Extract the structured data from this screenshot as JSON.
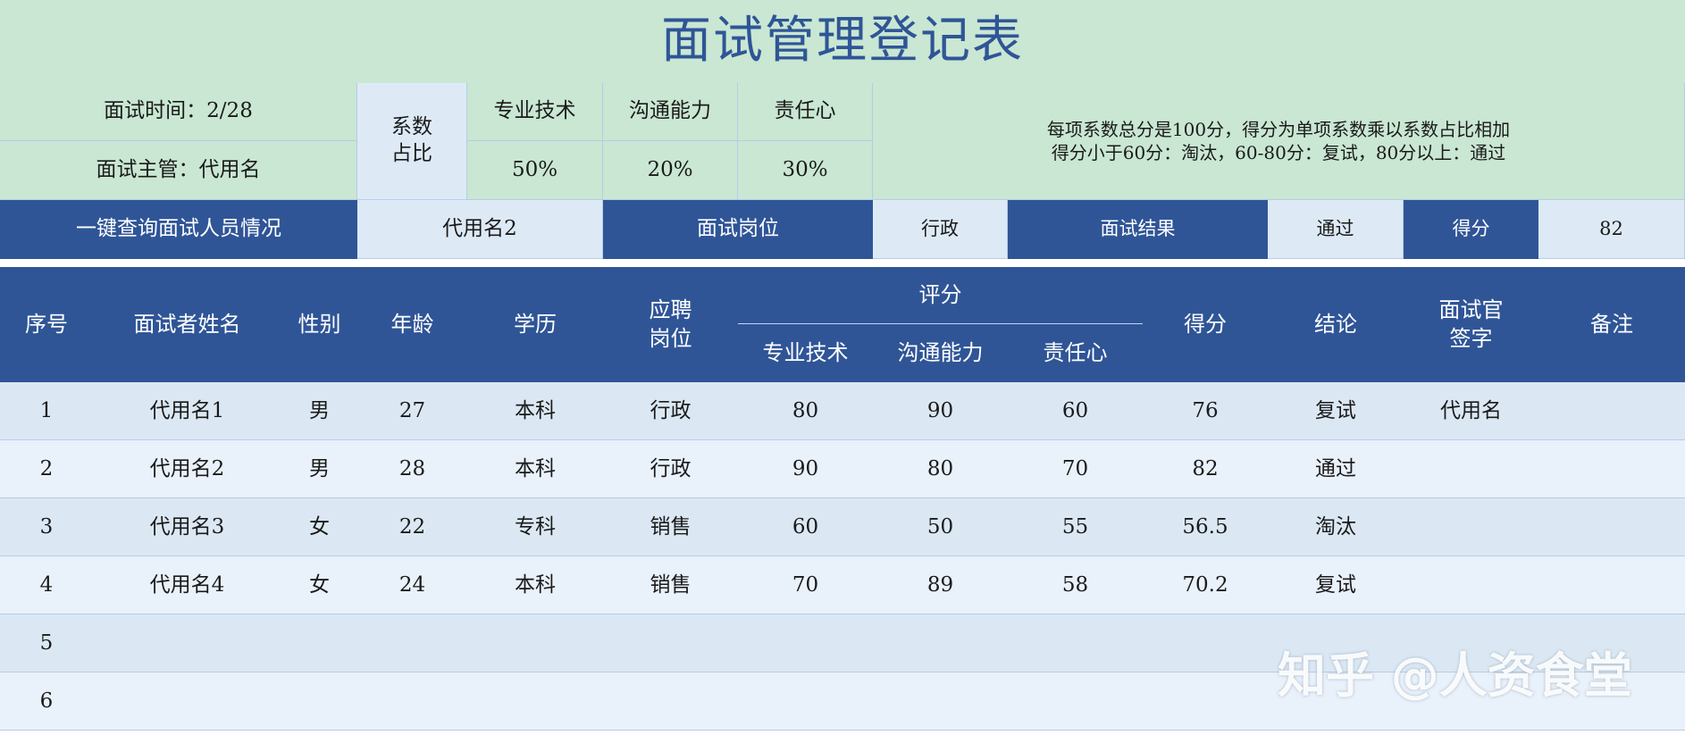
{
  "title": "面试管理登记表",
  "info": {
    "interview_date": "面试时间：2/28",
    "interview_manager": "面试主管：代用名",
    "coef_label_1": "系数",
    "coef_label_2": "占比",
    "skills": [
      "专业技术",
      "沟通能力",
      "责任心"
    ],
    "weights": [
      "50%",
      "20%",
      "30%"
    ],
    "rule_line_1": "每项系数总分是100分，得分为单项系数乘以系数占比相加",
    "rule_line_2": "得分小于60分：淘汰，60-80分：复试，80分以上：通过"
  },
  "query": {
    "label": "一键查询面试人员情况",
    "name_value": "代用名2",
    "position_label": "面试岗位",
    "position_value": "行政",
    "result_label": "面试结果",
    "result_value": "通过",
    "score_label": "得分",
    "score_value": "82"
  },
  "table": {
    "headers": {
      "seq": "序号",
      "name": "面试者姓名",
      "gender": "性别",
      "age": "年龄",
      "education": "学历",
      "position_1": "应聘",
      "position_2": "岗位",
      "rating": "评分",
      "skill": "专业技术",
      "communication": "沟通能力",
      "responsibility": "责任心",
      "score": "得分",
      "conclusion": "结论",
      "signature_1": "面试官",
      "signature_2": "签字",
      "remarks": "备注"
    },
    "rows": [
      {
        "seq": "1",
        "name": "代用名1",
        "gender": "男",
        "age": "27",
        "education": "本科",
        "position": "行政",
        "skill": "80",
        "communication": "90",
        "responsibility": "60",
        "score": "76",
        "conclusion": "复试",
        "signature": "代用名",
        "remarks": ""
      },
      {
        "seq": "2",
        "name": "代用名2",
        "gender": "男",
        "age": "28",
        "education": "本科",
        "position": "行政",
        "skill": "90",
        "communication": "80",
        "responsibility": "70",
        "score": "82",
        "conclusion": "通过",
        "signature": "",
        "remarks": ""
      },
      {
        "seq": "3",
        "name": "代用名3",
        "gender": "女",
        "age": "22",
        "education": "专科",
        "position": "销售",
        "skill": "60",
        "communication": "50",
        "responsibility": "55",
        "score": "56.5",
        "conclusion": "淘汰",
        "signature": "",
        "remarks": ""
      },
      {
        "seq": "4",
        "name": "代用名4",
        "gender": "女",
        "age": "24",
        "education": "本科",
        "position": "销售",
        "skill": "70",
        "communication": "89",
        "responsibility": "58",
        "score": "70.2",
        "conclusion": "复试",
        "signature": "",
        "remarks": ""
      },
      {
        "seq": "5",
        "name": "",
        "gender": "",
        "age": "",
        "education": "",
        "position": "",
        "skill": "",
        "communication": "",
        "responsibility": "",
        "score": "",
        "conclusion": "",
        "signature": "",
        "remarks": ""
      },
      {
        "seq": "6",
        "name": "",
        "gender": "",
        "age": "",
        "education": "",
        "position": "",
        "skill": "",
        "communication": "",
        "responsibility": "",
        "score": "",
        "conclusion": "",
        "signature": "",
        "remarks": ""
      }
    ]
  },
  "watermark": "知乎 @人资食堂"
}
